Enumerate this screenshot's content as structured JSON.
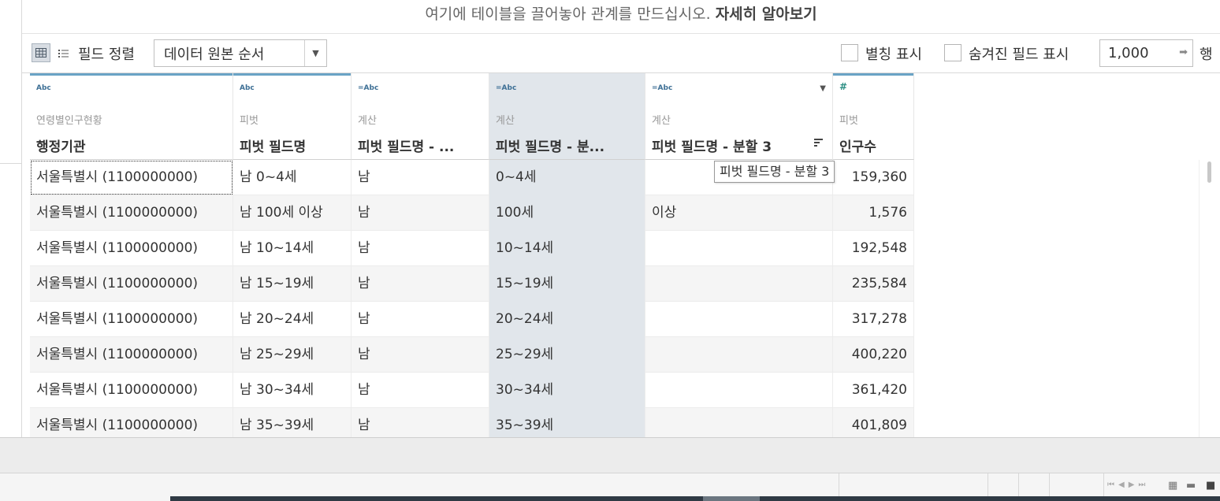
{
  "banner": {
    "text": "여기에 테이블을 끌어놓아 관계를 만드십시오.",
    "link": "자세히 알아보기"
  },
  "toolbar": {
    "sort_label": "필드 정렬",
    "sort_value": "데이터 원본 순서",
    "alias_label": "별칭 표시",
    "hidden_label": "숨겨진 필드 표시",
    "row_count": "1,000",
    "rows_label": "행"
  },
  "columns": [
    {
      "type": "Abc",
      "source": "연령별인구현황",
      "name": "행정기관"
    },
    {
      "type": "Abc",
      "source": "피벗",
      "name": "피벗 필드명"
    },
    {
      "type": "=Abc",
      "source": "계산",
      "name": "피벗 필드명 - ..."
    },
    {
      "type": "=Abc",
      "source": "계산",
      "name": "피벗 필드명 - 분..."
    },
    {
      "type": "=Abc",
      "source": "계산",
      "name": "피벗 필드명 - 분할 3"
    },
    {
      "type": "#",
      "source": "피벗",
      "name": "인구수"
    }
  ],
  "rows": [
    [
      "서울특별시  (1100000000)",
      "남 0~4세",
      "남",
      "0~4세",
      "",
      "159,360"
    ],
    [
      "서울특별시  (1100000000)",
      "남 100세 이상",
      "남",
      "100세",
      "이상",
      "1,576"
    ],
    [
      "서울특별시  (1100000000)",
      "남 10~14세",
      "남",
      "10~14세",
      "",
      "192,548"
    ],
    [
      "서울특별시  (1100000000)",
      "남 15~19세",
      "남",
      "15~19세",
      "",
      "235,584"
    ],
    [
      "서울특별시  (1100000000)",
      "남 20~24세",
      "남",
      "20~24세",
      "",
      "317,278"
    ],
    [
      "서울특별시  (1100000000)",
      "남 25~29세",
      "남",
      "25~29세",
      "",
      "400,220"
    ],
    [
      "서울특별시  (1100000000)",
      "남 30~34세",
      "남",
      "30~34세",
      "",
      "361,420"
    ],
    [
      "서울특별시  (1100000000)",
      "남 35~39세",
      "남",
      "35~39세",
      "",
      "401,809"
    ]
  ],
  "tooltip": "피벗 필드명 - 분할 3"
}
